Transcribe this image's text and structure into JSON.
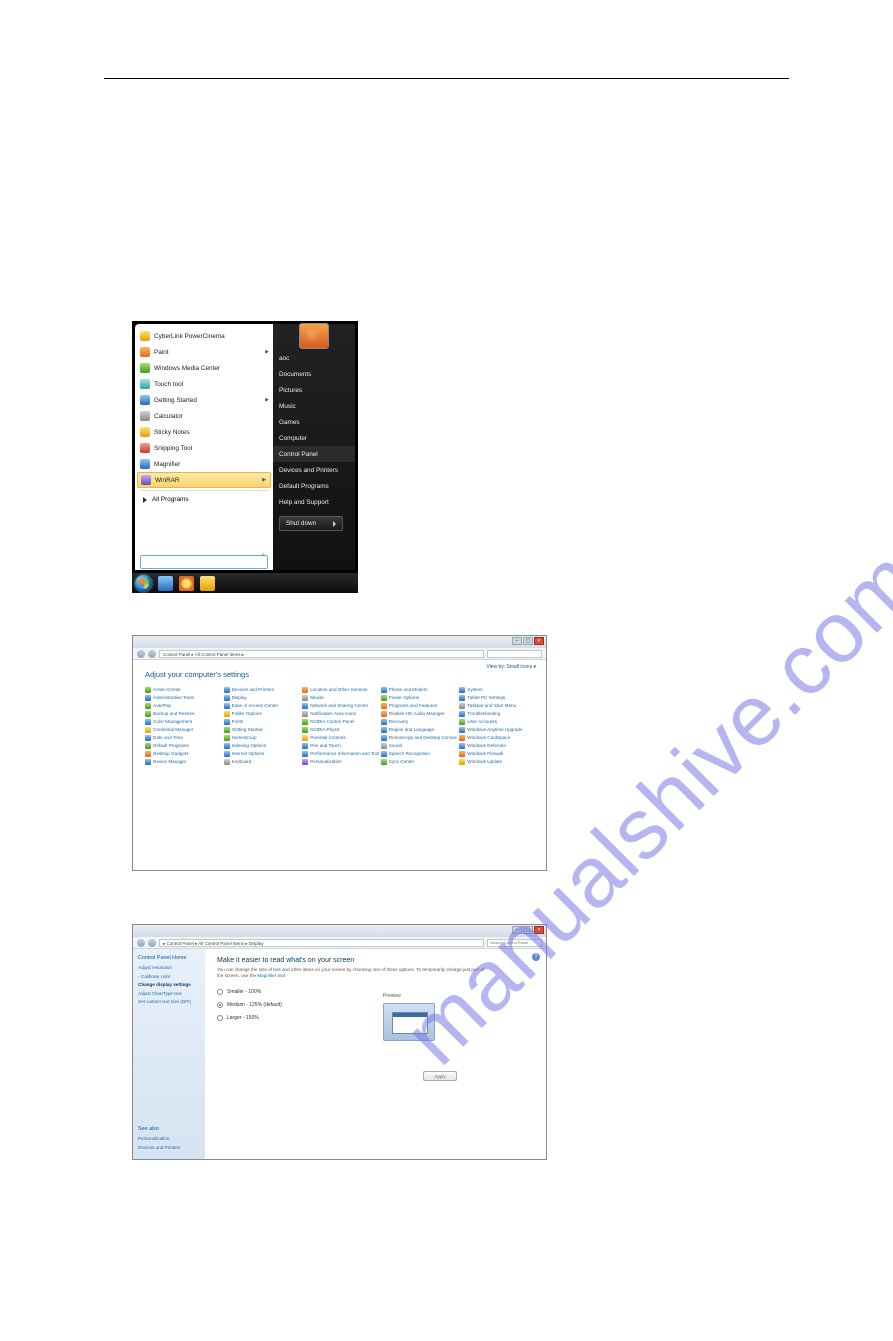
{
  "watermark": "manualshive.com",
  "start_menu": {
    "left_items": [
      {
        "label": "CyberLink PowerCinema",
        "icon_class": "c-yel",
        "arrow": false
      },
      {
        "label": "Paint",
        "icon_class": "c-org",
        "arrow": true
      },
      {
        "label": "Windows Media Center",
        "icon_class": "c-grn",
        "arrow": false
      },
      {
        "label": "Touch tool",
        "icon_class": "c-cyn",
        "arrow": false
      },
      {
        "label": "Getting Started",
        "icon_class": "c-blu",
        "arrow": true
      },
      {
        "label": "Calculator",
        "icon_class": "c-gry",
        "arrow": false
      },
      {
        "label": "Sticky Notes",
        "icon_class": "c-yel",
        "arrow": false
      },
      {
        "label": "Snipping Tool",
        "icon_class": "c-red",
        "arrow": false
      },
      {
        "label": "Magnifier",
        "icon_class": "c-blu",
        "arrow": false
      },
      {
        "label": "WinRAR",
        "icon_class": "c-pur",
        "arrow": true,
        "highlight": true
      }
    ],
    "all_programs": "All Programs",
    "search_placeholder": "",
    "right_items": [
      "aoc",
      "Documents",
      "Pictures",
      "Music",
      "Games",
      "Computer",
      "Control Panel",
      "Devices and Printers",
      "Default Programs",
      "Help and Support"
    ],
    "right_highlight_index": 6,
    "shutdown": "Shut down"
  },
  "control_panel": {
    "breadcrumb": "Control Panel ▸ All Control Panel Items ▸",
    "heading": "Adjust your computer's settings",
    "view_by": "View by:   Small icons ▾",
    "items": [
      {
        "label": "Action Center",
        "c": "c-grn"
      },
      {
        "label": "Administrative Tools",
        "c": "c-blu"
      },
      {
        "label": "AutoPlay",
        "c": "c-grn"
      },
      {
        "label": "Backup and Restore",
        "c": "c-grn"
      },
      {
        "label": "Color Management",
        "c": "c-blu"
      },
      {
        "label": "Credential Manager",
        "c": "c-yel"
      },
      {
        "label": "Date and Time",
        "c": "c-blu"
      },
      {
        "label": "Default Programs",
        "c": "c-grn"
      },
      {
        "label": "Desktop Gadgets",
        "c": "c-org"
      },
      {
        "label": "Device Manager",
        "c": "c-blu"
      },
      {
        "label": "Devices and Printers",
        "c": "c-blu"
      },
      {
        "label": "Display",
        "c": "c-blu"
      },
      {
        "label": "Ease of Access Center",
        "c": "c-blu"
      },
      {
        "label": "Folder Options",
        "c": "c-yel"
      },
      {
        "label": "Fonts",
        "c": "c-blu"
      },
      {
        "label": "Getting Started",
        "c": "c-grn"
      },
      {
        "label": "HomeGroup",
        "c": "c-grn"
      },
      {
        "label": "Indexing Options",
        "c": "c-blu"
      },
      {
        "label": "Internet Options",
        "c": "c-blu"
      },
      {
        "label": "Keyboard",
        "c": "c-gry"
      },
      {
        "label": "Location and Other Sensors",
        "c": "c-org"
      },
      {
        "label": "Mouse",
        "c": "c-gry"
      },
      {
        "label": "Network and Sharing Center",
        "c": "c-blu"
      },
      {
        "label": "Notification Area Icons",
        "c": "c-gry"
      },
      {
        "label": "NVIDIA Control Panel",
        "c": "c-grn"
      },
      {
        "label": "NVIDIA PhysX",
        "c": "c-grn"
      },
      {
        "label": "Parental Controls",
        "c": "c-yel"
      },
      {
        "label": "Pen and Touch",
        "c": "c-blu"
      },
      {
        "label": "Performance Information and Tools",
        "c": "c-blu"
      },
      {
        "label": "Personalization",
        "c": "c-pur"
      },
      {
        "label": "Phone and Modem",
        "c": "c-blu"
      },
      {
        "label": "Power Options",
        "c": "c-grn"
      },
      {
        "label": "Programs and Features",
        "c": "c-org"
      },
      {
        "label": "Realtek HD Audio Manager",
        "c": "c-org"
      },
      {
        "label": "Recovery",
        "c": "c-blu"
      },
      {
        "label": "Region and Language",
        "c": "c-blu"
      },
      {
        "label": "RemoteApp and Desktop Connections",
        "c": "c-blu"
      },
      {
        "label": "Sound",
        "c": "c-gry"
      },
      {
        "label": "Speech Recognition",
        "c": "c-blu"
      },
      {
        "label": "Sync Center",
        "c": "c-grn"
      },
      {
        "label": "System",
        "c": "c-blu"
      },
      {
        "label": "Tablet PC Settings",
        "c": "c-blu"
      },
      {
        "label": "Taskbar and Start Menu",
        "c": "c-gry"
      },
      {
        "label": "Troubleshooting",
        "c": "c-blu"
      },
      {
        "label": "User Accounts",
        "c": "c-grn"
      },
      {
        "label": "Windows Anytime Upgrade",
        "c": "c-blu"
      },
      {
        "label": "Windows CardSpace",
        "c": "c-org"
      },
      {
        "label": "Windows Defender",
        "c": "c-blu"
      },
      {
        "label": "Windows Firewall",
        "c": "c-org"
      },
      {
        "label": "Windows Update",
        "c": "c-yel"
      }
    ]
  },
  "display_settings": {
    "breadcrumb": "▸ Control Panel ▸ All Control Panel Items ▸ Display",
    "search_placeholder": "Search Control Panel",
    "side_heading": "Control Panel Home",
    "side_links": [
      {
        "label": "Adjust resolution"
      },
      {
        "label": "Calibrate color",
        "bullet": true
      },
      {
        "label": "Change display settings",
        "hl": true
      },
      {
        "label": "Adjust ClearType text"
      },
      {
        "label": "Set custom text size (DPI)"
      }
    ],
    "see_also_heading": "See also",
    "see_also": [
      "Personalization",
      "Devices and Printers"
    ],
    "main_heading": "Make it easier to read what's on your screen",
    "main_para": "You can change the size of text and other items on your screen by choosing one of these options. To temporarily enlarge just part of the screen, use the ",
    "main_para_link": "Magnifier",
    "main_para_tail": " tool.",
    "options": [
      {
        "label": "Smaller - 100%",
        "checked": false
      },
      {
        "label": "Medium - 125% (default)",
        "checked": true
      },
      {
        "label": "Larger - 150%",
        "checked": false
      }
    ],
    "preview_label": "Preview",
    "apply": "Apply"
  }
}
